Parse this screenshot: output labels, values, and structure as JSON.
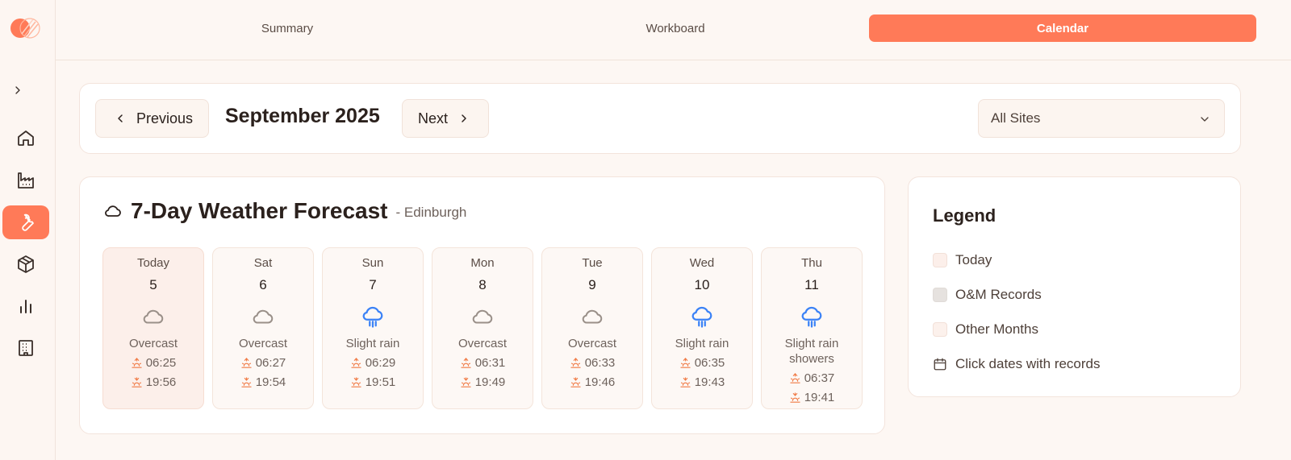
{
  "tabs": [
    "Summary",
    "Workboard",
    "Calendar"
  ],
  "active_tab": "Calendar",
  "sidebar": {
    "icons": [
      "expand-chevron-icon",
      "home-icon",
      "factory-icon",
      "wrench-icon",
      "box-icon",
      "bar-chart-icon",
      "building-icon"
    ],
    "active": "wrench-icon"
  },
  "month_nav": {
    "previous_label": "Previous",
    "next_label": "Next",
    "title": "September 2025"
  },
  "site_filter": {
    "value": "All Sites"
  },
  "forecast": {
    "title": "7-Day Weather Forecast",
    "location": "- Edinburgh",
    "days": [
      {
        "name": "Today",
        "date": "5",
        "condition": "Overcast",
        "icon": "cloud-icon",
        "sunrise": "06:25",
        "sunset": "19:56"
      },
      {
        "name": "Sat",
        "date": "6",
        "condition": "Overcast",
        "icon": "cloud-icon",
        "sunrise": "06:27",
        "sunset": "19:54"
      },
      {
        "name": "Sun",
        "date": "7",
        "condition": "Slight rain",
        "icon": "rain-icon",
        "sunrise": "06:29",
        "sunset": "19:51"
      },
      {
        "name": "Mon",
        "date": "8",
        "condition": "Overcast",
        "icon": "cloud-icon",
        "sunrise": "06:31",
        "sunset": "19:49"
      },
      {
        "name": "Tue",
        "date": "9",
        "condition": "Overcast",
        "icon": "cloud-icon",
        "sunrise": "06:33",
        "sunset": "19:46"
      },
      {
        "name": "Wed",
        "date": "10",
        "condition": "Slight rain",
        "icon": "rain-icon",
        "sunrise": "06:35",
        "sunset": "19:43"
      },
      {
        "name": "Thu",
        "date": "11",
        "condition": "Slight rain showers",
        "icon": "rain-icon",
        "sunrise": "06:37",
        "sunset": "19:41"
      }
    ]
  },
  "legend": {
    "title": "Legend",
    "items": [
      {
        "label": "Today",
        "color": "#fcefea"
      },
      {
        "label": "O&M Records",
        "color": "#e6e2df"
      },
      {
        "label": "Other Months",
        "color": "#fcf1ec"
      },
      {
        "label": "Click dates with records",
        "icon": "calendar-icon"
      }
    ]
  },
  "colors": {
    "accent": "#ff7a58",
    "rain_icon": "#3b82f6",
    "cloud_icon": "#9a9089",
    "sun_icon": "#f07a45"
  }
}
